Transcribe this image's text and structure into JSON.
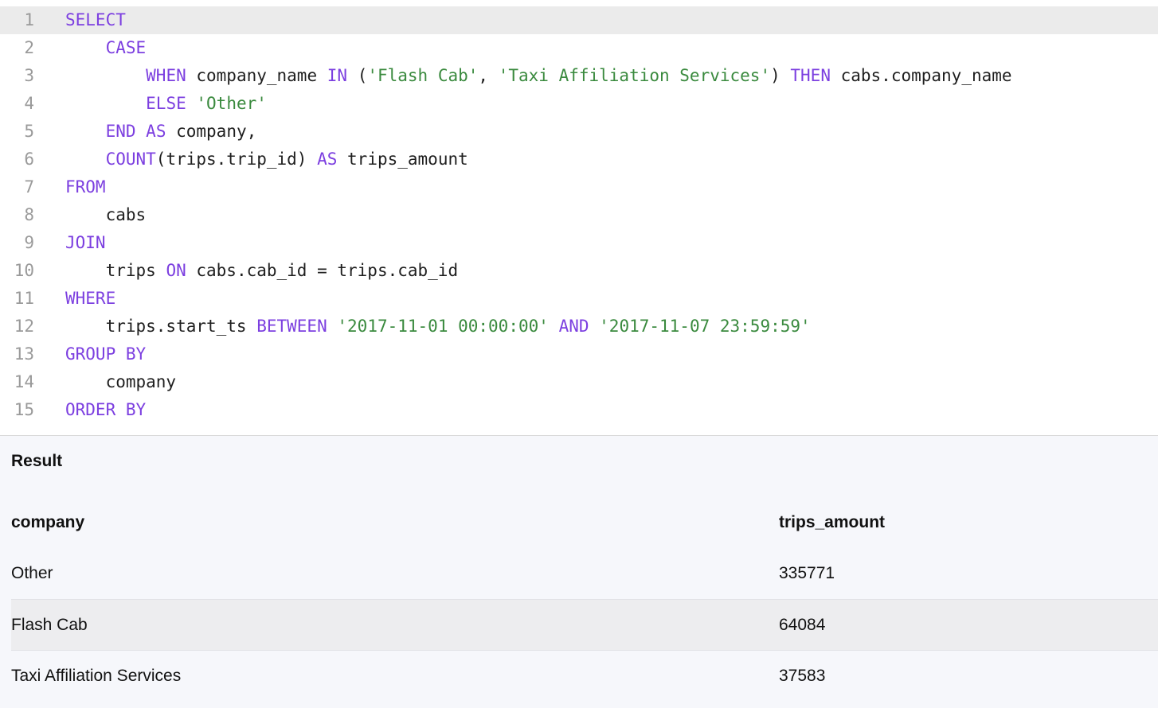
{
  "editor": {
    "active_line": 1,
    "lines": [
      {
        "n": "1",
        "tokens": [
          {
            "t": "SELECT",
            "k": "kw"
          }
        ]
      },
      {
        "n": "2",
        "tokens": [
          {
            "t": "    ",
            "k": "id"
          },
          {
            "t": "CASE",
            "k": "kw"
          }
        ]
      },
      {
        "n": "3",
        "tokens": [
          {
            "t": "        ",
            "k": "id"
          },
          {
            "t": "WHEN",
            "k": "kw"
          },
          {
            "t": " company_name ",
            "k": "id"
          },
          {
            "t": "IN",
            "k": "kw"
          },
          {
            "t": " (",
            "k": "id"
          },
          {
            "t": "'Flash Cab'",
            "k": "str"
          },
          {
            "t": ", ",
            "k": "id"
          },
          {
            "t": "'Taxi Affiliation Services'",
            "k": "str"
          },
          {
            "t": ") ",
            "k": "id"
          },
          {
            "t": "THEN",
            "k": "kw"
          },
          {
            "t": " cabs.company_name",
            "k": "id"
          }
        ]
      },
      {
        "n": "4",
        "tokens": [
          {
            "t": "        ",
            "k": "id"
          },
          {
            "t": "ELSE",
            "k": "kw"
          },
          {
            "t": " ",
            "k": "id"
          },
          {
            "t": "'Other'",
            "k": "str"
          }
        ]
      },
      {
        "n": "5",
        "tokens": [
          {
            "t": "    ",
            "k": "id"
          },
          {
            "t": "END",
            "k": "kw"
          },
          {
            "t": " ",
            "k": "id"
          },
          {
            "t": "AS",
            "k": "kw"
          },
          {
            "t": " company,",
            "k": "id"
          }
        ]
      },
      {
        "n": "6",
        "tokens": [
          {
            "t": "    ",
            "k": "id"
          },
          {
            "t": "COUNT",
            "k": "kw"
          },
          {
            "t": "(trips.trip_id) ",
            "k": "id"
          },
          {
            "t": "AS",
            "k": "kw"
          },
          {
            "t": " trips_amount",
            "k": "id"
          }
        ]
      },
      {
        "n": "7",
        "tokens": [
          {
            "t": "FROM",
            "k": "kw"
          }
        ]
      },
      {
        "n": "8",
        "tokens": [
          {
            "t": "    cabs",
            "k": "id"
          }
        ]
      },
      {
        "n": "9",
        "tokens": [
          {
            "t": "JOIN",
            "k": "kw"
          }
        ]
      },
      {
        "n": "10",
        "tokens": [
          {
            "t": "    trips ",
            "k": "id"
          },
          {
            "t": "ON",
            "k": "kw"
          },
          {
            "t": " cabs.cab_id = trips.cab_id",
            "k": "id"
          }
        ]
      },
      {
        "n": "11",
        "tokens": [
          {
            "t": "WHERE",
            "k": "kw"
          }
        ]
      },
      {
        "n": "12",
        "tokens": [
          {
            "t": "    trips.start_ts ",
            "k": "id"
          },
          {
            "t": "BETWEEN",
            "k": "kw"
          },
          {
            "t": " ",
            "k": "id"
          },
          {
            "t": "'2017-11-01 00:00:00'",
            "k": "str"
          },
          {
            "t": " ",
            "k": "id"
          },
          {
            "t": "AND",
            "k": "kw"
          },
          {
            "t": " ",
            "k": "id"
          },
          {
            "t": "'2017-11-07 23:59:59'",
            "k": "str"
          }
        ]
      },
      {
        "n": "13",
        "tokens": [
          {
            "t": "GROUP BY",
            "k": "kw"
          }
        ]
      },
      {
        "n": "14",
        "tokens": [
          {
            "t": "    company",
            "k": "id"
          }
        ]
      },
      {
        "n": "15",
        "tokens": [
          {
            "t": "ORDER BY",
            "k": "kw"
          }
        ]
      }
    ]
  },
  "colors": {
    "keyword": "#7c3fe0",
    "string": "#3a8a3e",
    "identifier": "#1f1f1f",
    "line_number": "#9a9a9a",
    "active_line_bg": "#ebebeb",
    "result_bg": "#f6f7fb",
    "stripe_bg": "#ededef"
  },
  "result": {
    "title": "Result",
    "columns": [
      "company",
      "trips_amount"
    ],
    "rows": [
      [
        "Other",
        "335771"
      ],
      [
        "Flash Cab",
        "64084"
      ],
      [
        "Taxi Affiliation Services",
        "37583"
      ]
    ]
  }
}
